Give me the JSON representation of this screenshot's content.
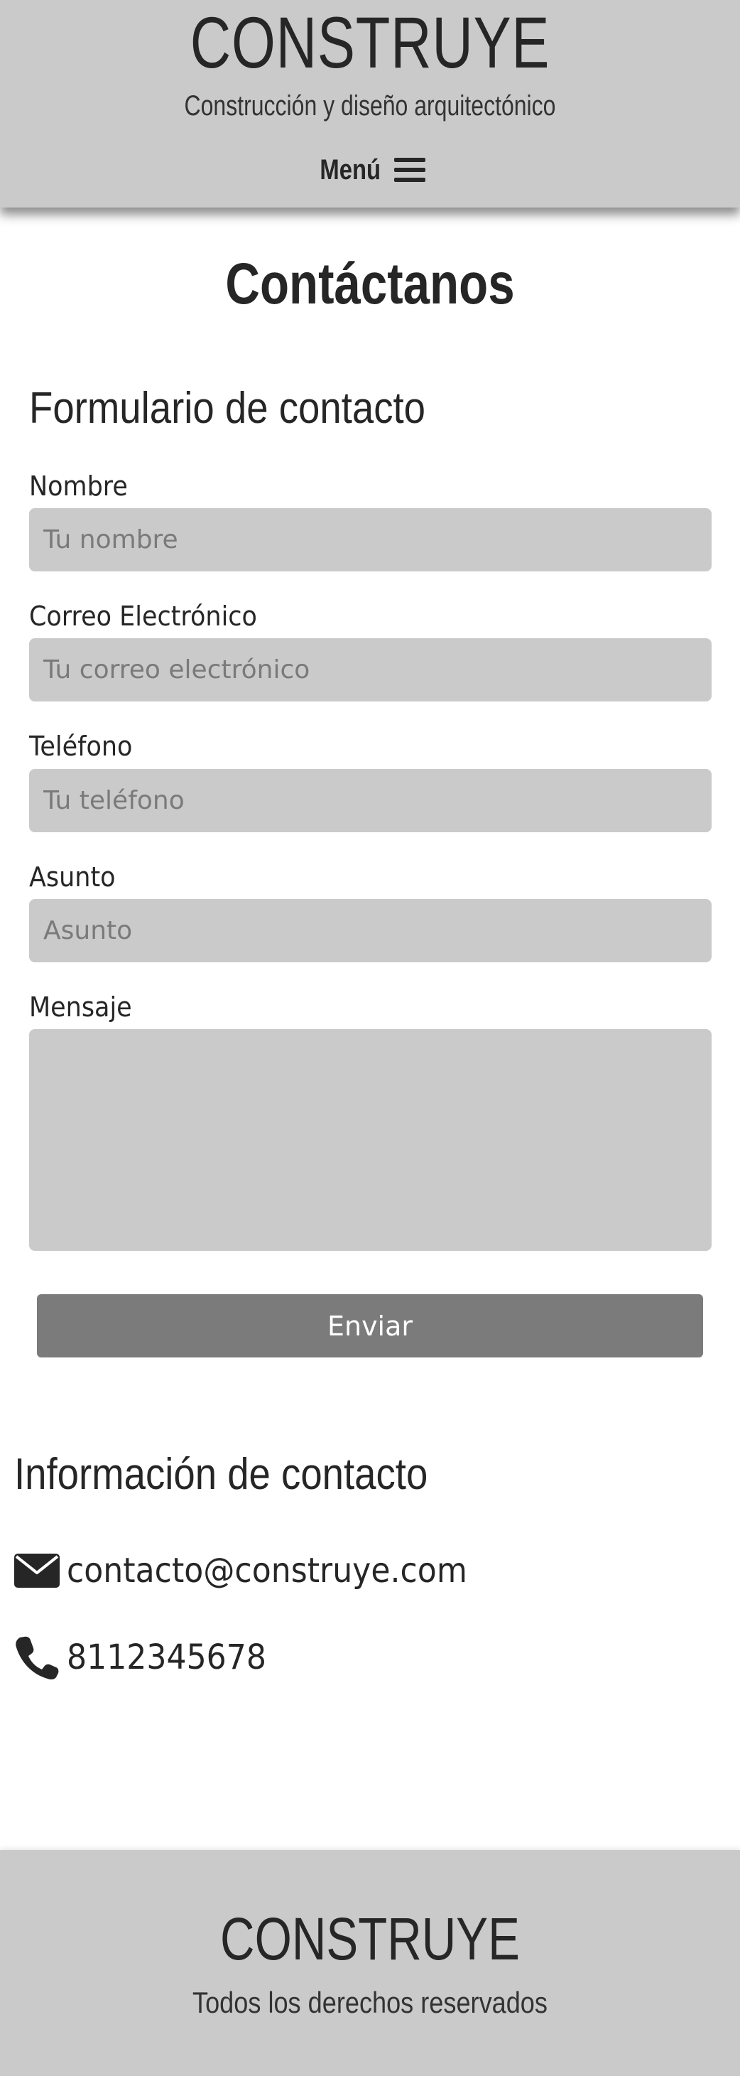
{
  "header": {
    "brand": "CONSTRUYE",
    "tagline": "Construcción y diseño arquitectónico",
    "menu_label": "Menú",
    "menu_icon": "hamburger-icon"
  },
  "main": {
    "title": "Contáctanos",
    "form": {
      "title": "Formulario de contacto",
      "fields": [
        {
          "label": "Nombre",
          "placeholder": "Tu nombre",
          "value": ""
        },
        {
          "label": "Correo Electrónico",
          "placeholder": "Tu correo electrónico",
          "value": ""
        },
        {
          "label": "Teléfono",
          "placeholder": "Tu teléfono",
          "value": ""
        },
        {
          "label": "Asunto",
          "placeholder": "Asunto",
          "value": ""
        }
      ],
      "message": {
        "label": "Mensaje",
        "placeholder": "",
        "value": ""
      },
      "submit_label": "Enviar"
    },
    "contact_info": {
      "title": "Información de contacto",
      "email": "contacto@construye.com",
      "email_icon": "envelope-icon",
      "phone": "8112345678",
      "phone_icon": "phone-icon"
    }
  },
  "footer": {
    "brand": "CONSTRUYE",
    "copyright": "Todos los derechos reservados"
  },
  "colors": {
    "header_bg": "#cacaca",
    "input_bg": "#cacaca",
    "button_bg": "#7b7b7b",
    "text": "#262626"
  }
}
